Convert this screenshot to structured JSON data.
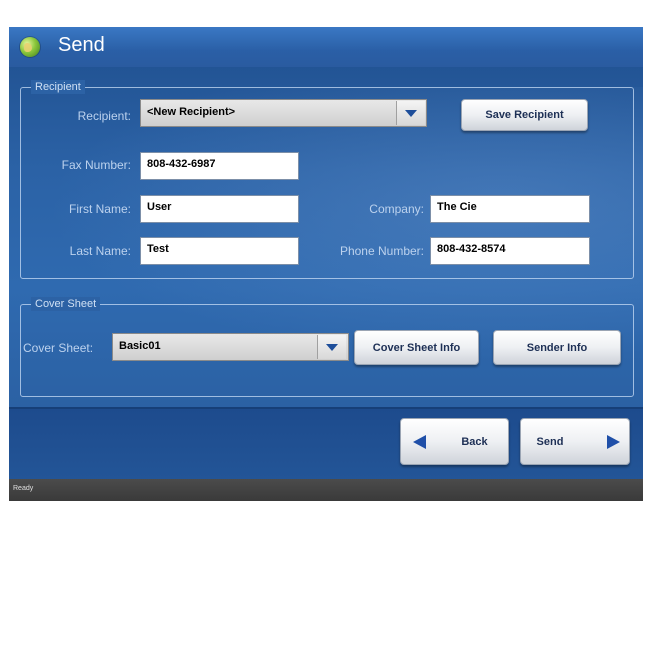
{
  "window": {
    "title": "Send"
  },
  "recipient_group": {
    "legend": "Recipient",
    "recipient_label": "Recipient:",
    "recipient_value": "<New Recipient>",
    "save_button": "Save Recipient",
    "fax_label": "Fax Number:",
    "fax_value": "808-432-6987",
    "first_name_label": "First Name:",
    "first_name_value": "User",
    "company_label": "Company:",
    "company_value": "The Cie",
    "last_name_label": "Last Name:",
    "last_name_value": "Test",
    "phone_label": "Phone Number:",
    "phone_value": "808-432-8574"
  },
  "cover_group": {
    "legend": "Cover Sheet",
    "cover_label": "Cover Sheet:",
    "cover_value": "Basic01",
    "cover_info_button": "Cover Sheet Info",
    "sender_info_button": "Sender Info"
  },
  "nav": {
    "back": "Back",
    "send": "Send"
  },
  "status": {
    "text": "Ready"
  },
  "colors": {
    "arrow": "#1f4fa8",
    "background": "#2b62a6"
  }
}
